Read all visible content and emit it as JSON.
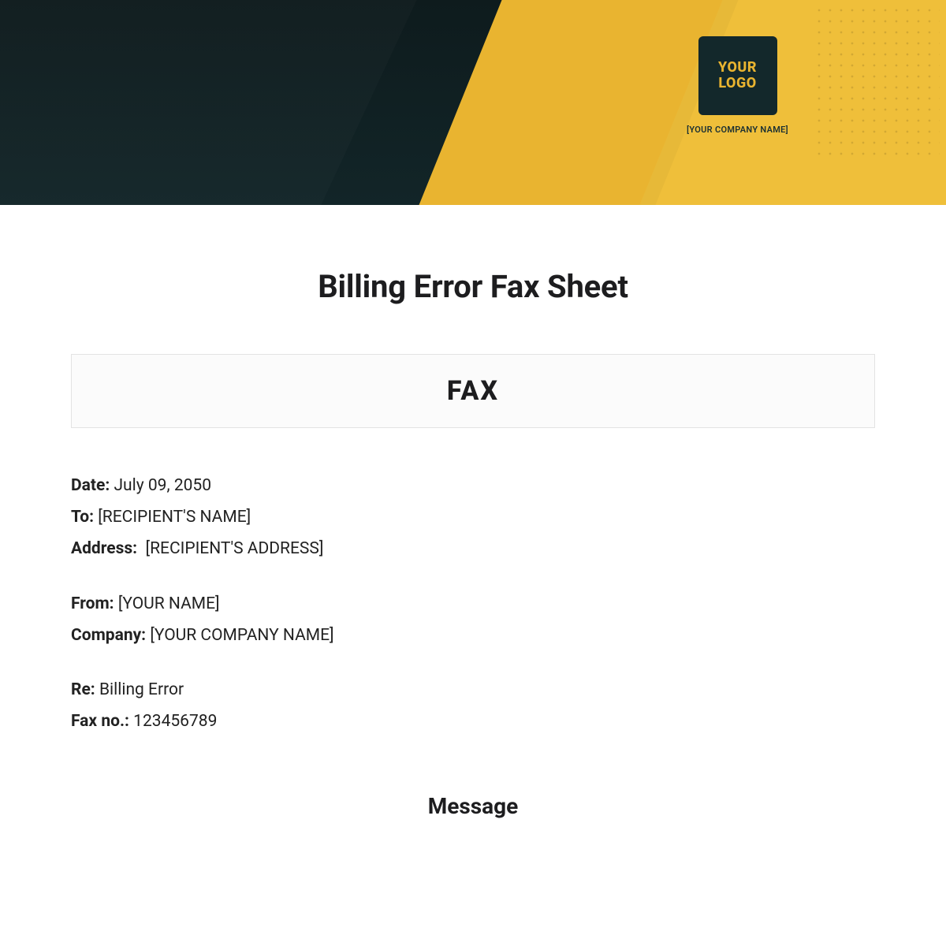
{
  "header": {
    "logo_text": "YOUR LOGO",
    "company_name_placeholder": "[YOUR COMPANY NAME]"
  },
  "document": {
    "title": "Billing Error Fax Sheet",
    "fax_heading": "FAX"
  },
  "fields": {
    "date_label": "Date:",
    "date_value": "July 09, 2050",
    "to_label": "To:",
    "to_value": "[RECIPIENT'S NAME]",
    "address_label": "Address:",
    "address_value": "[RECIPIENT'S ADDRESS]",
    "from_label": "From:",
    "from_value": "[YOUR NAME]",
    "company_label": "Company:",
    "company_value": "[YOUR COMPANY NAME]",
    "re_label": "Re:",
    "re_value": "Billing Error",
    "faxno_label": "Fax no.:",
    "faxno_value": "123456789"
  },
  "sections": {
    "message_heading": "Message"
  }
}
